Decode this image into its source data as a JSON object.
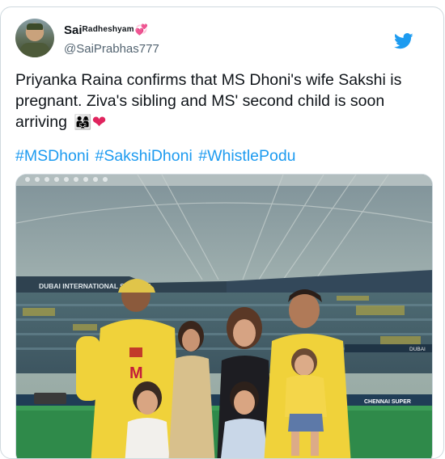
{
  "user": {
    "display_name_main": "Sai",
    "display_name_small": "Radheshyam",
    "display_name_emoji": "💞",
    "handle": "@SaiPrabhas777"
  },
  "icons": {
    "platform": "twitter-bird-icon",
    "avatar": "avatar"
  },
  "colors": {
    "brand_blue": "#1d9bf0",
    "text": "#0f1419",
    "secondary": "#536471",
    "border": "#cfd9de",
    "heart": "#e0245e"
  },
  "tweet": {
    "text": "Priyanka Raina confirms that MS Dhoni's wife Sakshi is pregnant. Ziva's sibling and MS' second child is soon arriving",
    "emoji_1": "👨‍👩‍👧",
    "emoji_2": "❤",
    "hashtags": [
      "#MSDhoni",
      "#SakshiDhoni",
      "#WhistlePodu"
    ]
  },
  "photo": {
    "stadium_sign": "DUBAI INTERNATIONAL STADIUM",
    "banner_right": "DUBAI",
    "board_right": "CHENNAI SUPER",
    "jersey_logo": "M"
  }
}
